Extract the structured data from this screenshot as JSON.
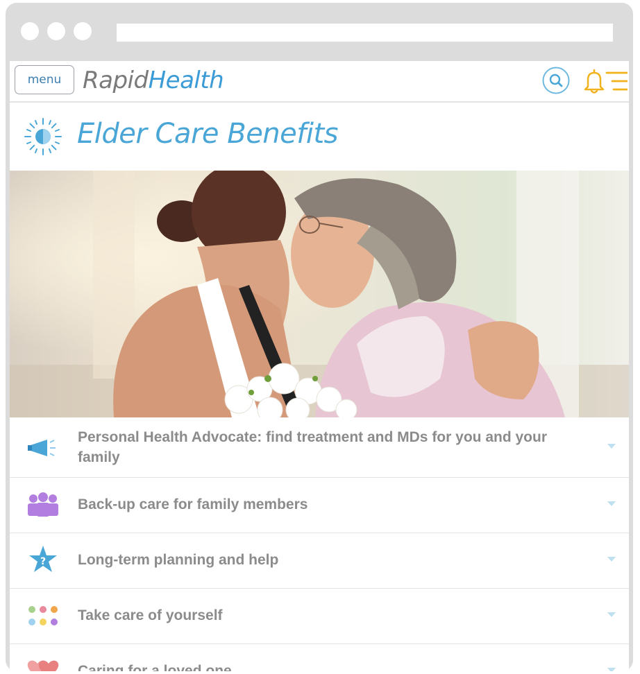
{
  "header": {
    "menu_label": "menu",
    "logo_part1": "Rapid",
    "logo_part2": "Health"
  },
  "page": {
    "title": "Elder Care Benefits"
  },
  "benefits": [
    {
      "label": "Personal Health Advocate: find treatment and MDs for you and your family",
      "icon": "megaphone-icon"
    },
    {
      "label": "Back-up care for family members",
      "icon": "family-icon"
    },
    {
      "label": "Long-term planning and help",
      "icon": "star-question-icon"
    },
    {
      "label": "Take care of yourself",
      "icon": "dots-grid-icon"
    },
    {
      "label": "Caring for a loved one",
      "icon": "hearts-icon"
    }
  ],
  "colors": {
    "accent_blue": "#4aa6d6",
    "logo_gray": "#7a7a7a",
    "bell_yellow": "#f2b21c",
    "family_purple": "#b27fe0"
  }
}
